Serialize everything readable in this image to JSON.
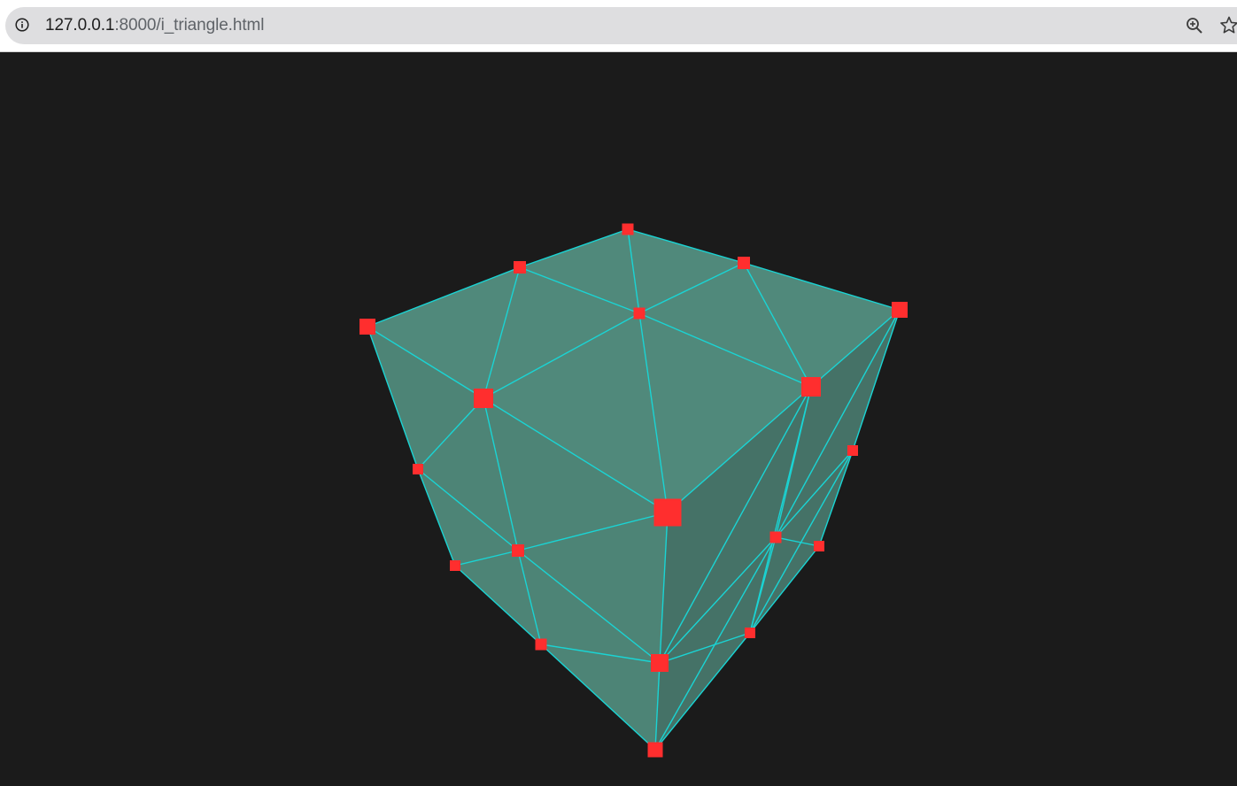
{
  "browser": {
    "url_host": "127.0.0.1",
    "url_path": ":8000/i_triangle.html",
    "site_info_icon": "info-icon",
    "zoom_icon": "zoom-in-icon",
    "bookmark_icon": "star-outline-icon"
  },
  "scene": {
    "background_color": "#1b1b1b",
    "face_fill_color": "#5fa896",
    "edge_color": "#1ad4d4",
    "vertex_color": "#ff2e2e"
  }
}
